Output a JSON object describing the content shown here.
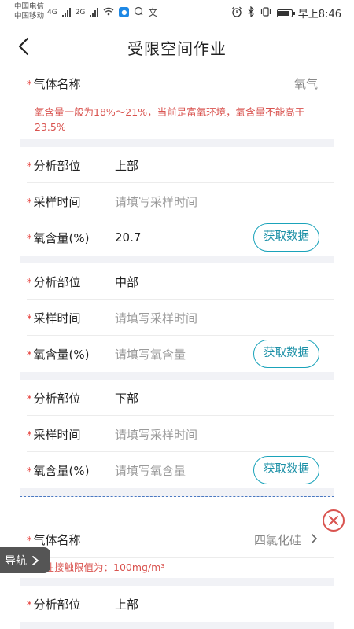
{
  "status_bar": {
    "carrier_1": "中国电信",
    "carrier_2": "中国移动",
    "net_1": "4G",
    "net_2": "2G",
    "time": "早上8:46",
    "badge_letter": "文"
  },
  "header": {
    "title": "受限空间作业"
  },
  "card1": {
    "gas_label": "气体名称",
    "gas_value": "氧气",
    "note": "氧含量一般为18%～21%，当前是富氧环境，氧含量不能高于23.5%",
    "groups": [
      {
        "part_label": "分析部位",
        "part_value": "上部",
        "time_label": "采样时间",
        "time_placeholder": "请填写采样时间",
        "o2_label": "氧含量(%)",
        "o2_value": "20.7",
        "button": "获取数据"
      },
      {
        "part_label": "分析部位",
        "part_value": "中部",
        "time_label": "采样时间",
        "time_placeholder": "请填写采样时间",
        "o2_label": "氧含量(%)",
        "o2_placeholder": "请填写氧含量",
        "button": "获取数据"
      },
      {
        "part_label": "分析部位",
        "part_value": "下部",
        "time_label": "采样时间",
        "time_placeholder": "请填写采样时间",
        "o2_label": "氧含量(%)",
        "o2_placeholder": "请填写氧含量",
        "button": "获取数据"
      }
    ]
  },
  "card2": {
    "gas_label": "气体名称",
    "gas_value": "四氯化硅",
    "note": "毒性接触限值为：100mg/m³",
    "part_label": "分析部位",
    "part_value": "上部"
  },
  "nav_float": {
    "label": "导航"
  },
  "required_mark": "*",
  "colors": {
    "accent": "#1aa3ba",
    "warning_text": "#d9534f",
    "card_border": "#4a78c2"
  }
}
